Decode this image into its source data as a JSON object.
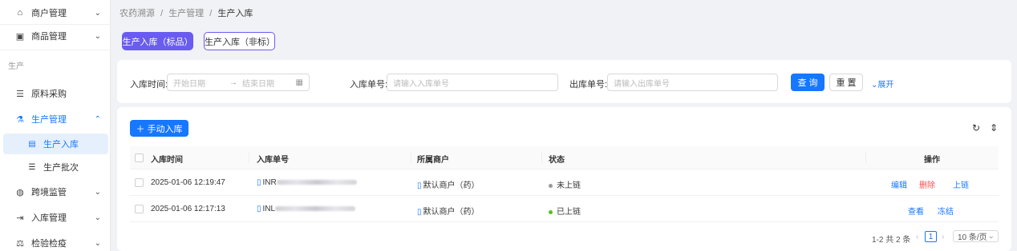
{
  "sidebar": {
    "items": [
      {
        "label": "商户管理",
        "icon": "bank-icon",
        "glyph": "⌂"
      },
      {
        "label": "商品管理",
        "icon": "image-icon",
        "glyph": "▣"
      },
      {
        "label": "原料采购",
        "icon": "list-icon",
        "glyph": "☰"
      },
      {
        "label": "生产管理",
        "icon": "flask-icon",
        "glyph": "⚗"
      },
      {
        "label": "跨境监管",
        "icon": "globe-icon",
        "glyph": "◍"
      },
      {
        "label": "入库管理",
        "icon": "login-icon",
        "glyph": "⇥"
      },
      {
        "label": "检验检疫",
        "icon": "experiment-icon",
        "glyph": "⚖"
      }
    ],
    "group_label": "生产",
    "subitems": [
      {
        "label": "生产入库",
        "icon": "file-icon",
        "glyph": "▤"
      },
      {
        "label": "生产批次",
        "icon": "list-icon",
        "glyph": "☰"
      }
    ]
  },
  "breadcrumb": [
    "农药溯源",
    "/",
    "生产管理",
    "/",
    "生产入库"
  ],
  "tabs": {
    "standard": "生产入库（标品）",
    "nonstandard": "生产入库（非标）"
  },
  "search": {
    "time_label": "入库时间:",
    "start_placeholder": "开始日期",
    "range_arrow": "→",
    "end_placeholder": "结束日期",
    "in_no_label": "入库单号:",
    "in_no_placeholder": "请输入入库单号",
    "out_no_label": "出库单号:",
    "out_no_placeholder": "请输入出库单号",
    "query": "查 询",
    "reset": "重 置",
    "expand": "展开"
  },
  "table": {
    "add_button": "＋ 手动入库",
    "columns": [
      "入库时间",
      "入库单号",
      "所属商户",
      "状态",
      "操作"
    ],
    "rows": [
      {
        "time": "2025-01-06 12:19:47",
        "no_prefix": "INR",
        "merchant": "默认商户（药）",
        "status": "未上链",
        "status_color": "#999999",
        "actions": [
          "编辑",
          "删除",
          "上链"
        ]
      },
      {
        "time": "2025-01-06 12:17:13",
        "no_prefix": "INL",
        "merchant": "默认商户（药）",
        "status": "已上链",
        "status_color": "#52c41a",
        "actions": [
          "查看",
          "冻结"
        ]
      }
    ],
    "colors": {
      "link": "#1677ff",
      "danger": "#ff4d4f"
    }
  },
  "pagination": {
    "summary": "1-2 共 2 条",
    "prev": "‹",
    "current": "1",
    "next": "›",
    "page_size": "10 条/页"
  }
}
